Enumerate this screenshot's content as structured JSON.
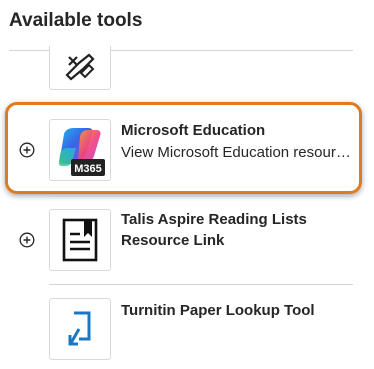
{
  "panel": {
    "title": "Available tools"
  },
  "tools": [
    {
      "name": "",
      "description": "",
      "icon": "tool-glyph-icon",
      "partial": true
    },
    {
      "name": "Microsoft Education",
      "description": "View Microsoft Education resources",
      "icon": "m365-icon",
      "icon_label": "M365",
      "highlighted": true
    },
    {
      "name": "Talis Aspire Reading Lists Resource Link",
      "description": "",
      "icon": "reading-list-icon"
    },
    {
      "name": "Turnitin Paper Lookup Tool",
      "description": "",
      "icon": "paper-lookup-icon"
    }
  ],
  "colors": {
    "highlight": "#e07a1f",
    "text": "#262626",
    "divider": "#d4d4d4",
    "lookup_blue": "#1a78c2"
  }
}
